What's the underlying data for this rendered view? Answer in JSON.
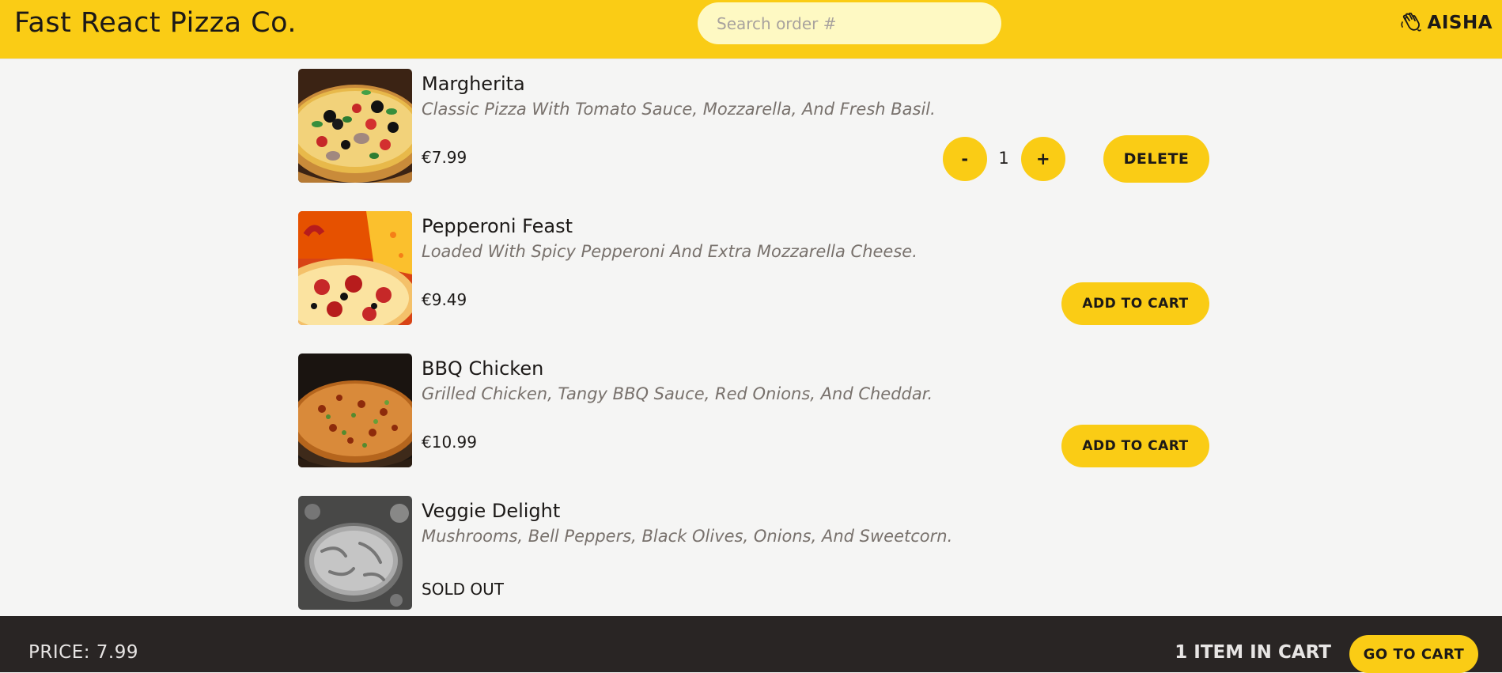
{
  "header": {
    "logo": "Fast React Pizza Co.",
    "search_placeholder": "Search order #",
    "user_name": "AISHA",
    "user_icon": "waving-hand-icon"
  },
  "menu": {
    "items": [
      {
        "name": "Margherita",
        "description": "Classic Pizza With Tomato Sauce, Mozzarella, And Fresh Basil.",
        "price": "€7.99",
        "in_cart": true,
        "quantity": "1",
        "decrease_label": "-",
        "increase_label": "+",
        "delete_label": "DELETE"
      },
      {
        "name": "Pepperoni Feast",
        "description": "Loaded With Spicy Pepperoni And Extra Mozzarella Cheese.",
        "price": "€9.49",
        "in_cart": false,
        "add_label": "ADD TO CART"
      },
      {
        "name": "BBQ Chicken",
        "description": "Grilled Chicken, Tangy BBQ Sauce, Red Onions, And Cheddar.",
        "price": "€10.99",
        "in_cart": false,
        "add_label": "ADD TO CART"
      },
      {
        "name": "Veggie Delight",
        "description": "Mushrooms, Bell Peppers, Black Olives, Onions, And Sweetcorn.",
        "sold_out_label": "SOLD OUT",
        "sold_out": true
      }
    ]
  },
  "footer": {
    "price_text": "PRICE: 7.99",
    "cart_count_text": "1 ITEM IN CART",
    "go_to_cart_label": "GO TO CART"
  },
  "colors": {
    "accent": "#facc15",
    "background": "#f5f5f4",
    "footer": "#292524"
  }
}
